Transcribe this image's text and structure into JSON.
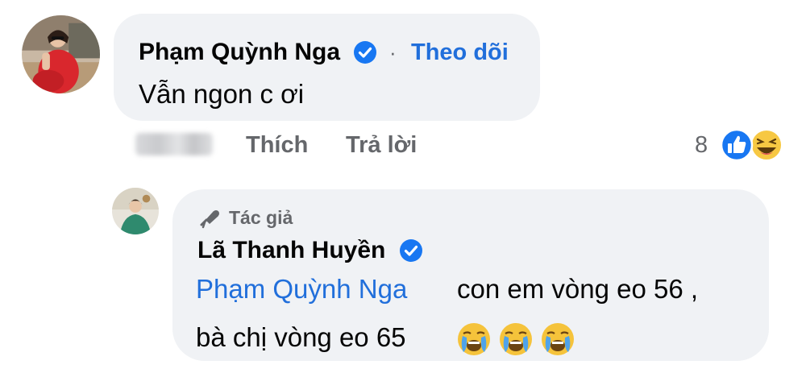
{
  "comment": {
    "author": "Phạm Quỳnh Nga",
    "follow_label": "Theo dõi",
    "separator": "·",
    "text": "Vẫn ngon c ơi",
    "actions": {
      "like": "Thích",
      "reply": "Trả lời"
    },
    "reactions": {
      "count": "8",
      "types": [
        "like-icon",
        "haha-icon"
      ]
    }
  },
  "reply": {
    "badge": "Tác giả",
    "badge_icon": "megaphone-icon",
    "author": "Lã Thanh Huyền",
    "mention": "Phạm Quỳnh Nga",
    "line1_rest": "con em vòng eo 56 ,",
    "line2": "bà chị vòng eo 65",
    "emojis": [
      "crying-face-icon",
      "crying-face-icon",
      "crying-face-icon"
    ]
  },
  "colors": {
    "link": "#216fdb",
    "bubble": "#f0f2f5",
    "muted": "#65676b",
    "verified": "#1877f2"
  }
}
